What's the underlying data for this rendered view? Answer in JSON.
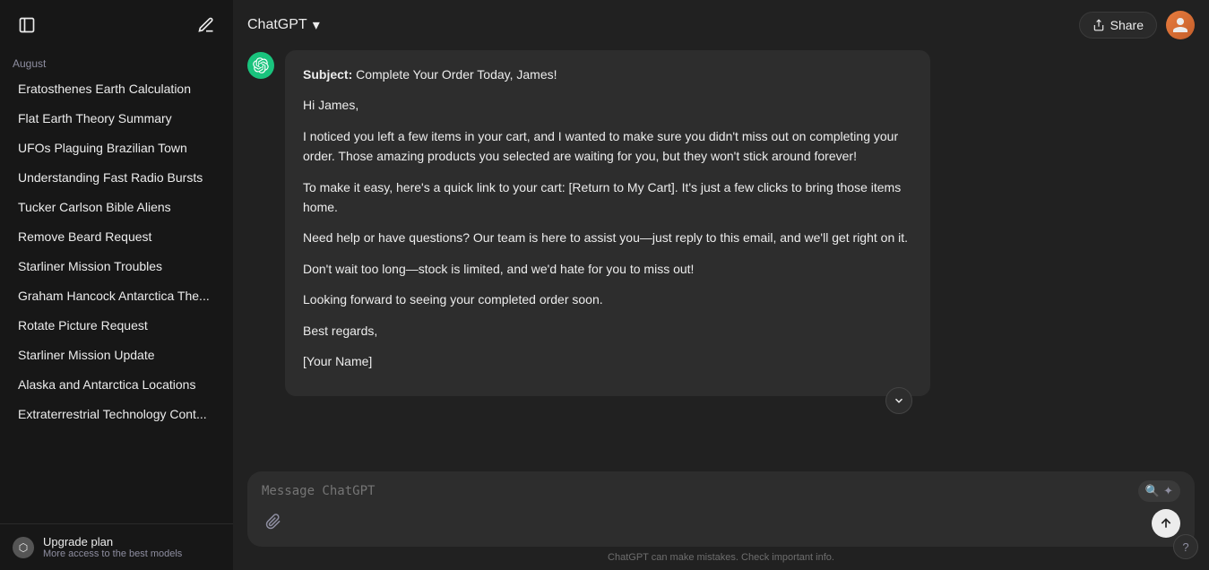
{
  "app": {
    "title": "ChatGPT",
    "title_chevron": "▾"
  },
  "topbar": {
    "share_label": "Share",
    "avatar_emoji": "🧑"
  },
  "sidebar": {
    "toggle_icon": "☰",
    "edit_icon": "✎",
    "section_label": "August",
    "items": [
      {
        "id": "eratosthenes",
        "label": "Eratosthenes Earth Calculation"
      },
      {
        "id": "flat-earth",
        "label": "Flat Earth Theory Summary"
      },
      {
        "id": "ufos",
        "label": "UFOs Plaguing Brazilian Town"
      },
      {
        "id": "radio-bursts",
        "label": "Understanding Fast Radio Bursts"
      },
      {
        "id": "tucker",
        "label": "Tucker Carlson Bible Aliens"
      },
      {
        "id": "beard",
        "label": "Remove Beard Request"
      },
      {
        "id": "starliner",
        "label": "Starliner Mission Troubles"
      },
      {
        "id": "graham",
        "label": "Graham Hancock Antarctica The..."
      },
      {
        "id": "rotate",
        "label": "Rotate Picture Request"
      },
      {
        "id": "starliner2",
        "label": "Starliner Mission Update"
      },
      {
        "id": "alaska",
        "label": "Alaska and Antarctica Locations"
      },
      {
        "id": "extraterrestrial",
        "label": "Extraterrestrial Technology Cont..."
      }
    ],
    "upgrade": {
      "title": "Upgrade plan",
      "subtitle": "More access to the best models"
    }
  },
  "message": {
    "subject_label": "Subject:",
    "subject_value": " Complete Your Order Today, James!",
    "paragraphs": [
      "Hi James,",
      "I noticed you left a few items in your cart, and I wanted to make sure you didn't miss out on completing your order. Those amazing products you selected are waiting for you, but they won't stick around forever!",
      "To make it easy, here's a quick link to your cart: [Return to My Cart]. It's just a few clicks to bring those items home.",
      "Need help or have questions? Our team is here to assist you—just reply to this email, and we'll get right on it.",
      "Don't wait too long—stock is limited, and we'd hate for you to miss out!",
      "Looking forward to seeing your completed order soon.",
      "Best regards,",
      "[Your Name]"
    ]
  },
  "input": {
    "placeholder": "Message ChatGPT"
  },
  "footer": {
    "note": "ChatGPT can make mistakes. Check important info."
  },
  "help_btn": "?"
}
